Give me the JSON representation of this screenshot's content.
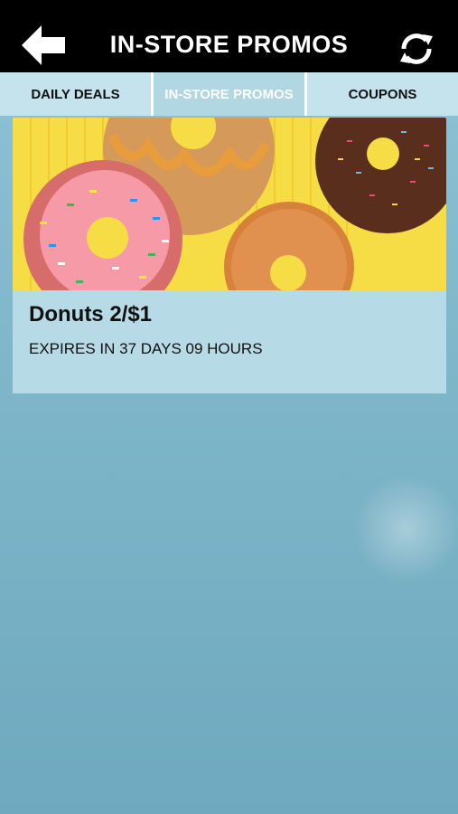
{
  "header": {
    "title": "IN-STORE PROMOS",
    "back_icon": "back-arrow-icon",
    "refresh_icon": "refresh-icon"
  },
  "tabs": [
    {
      "label": "DAILY DEALS",
      "active": false
    },
    {
      "label": "IN-STORE PROMOS",
      "active": true
    },
    {
      "label": "COUPONS",
      "active": false
    }
  ],
  "promos": [
    {
      "title": "Donuts 2/$1",
      "expiry": "EXPIRES IN 37 DAYS 09 HOURS"
    }
  ],
  "colors": {
    "header_bg": "#000000",
    "tab_bg": "#c5e3ec",
    "card_bg": "#b6dbe6",
    "image_bg": "#f7e04a"
  }
}
